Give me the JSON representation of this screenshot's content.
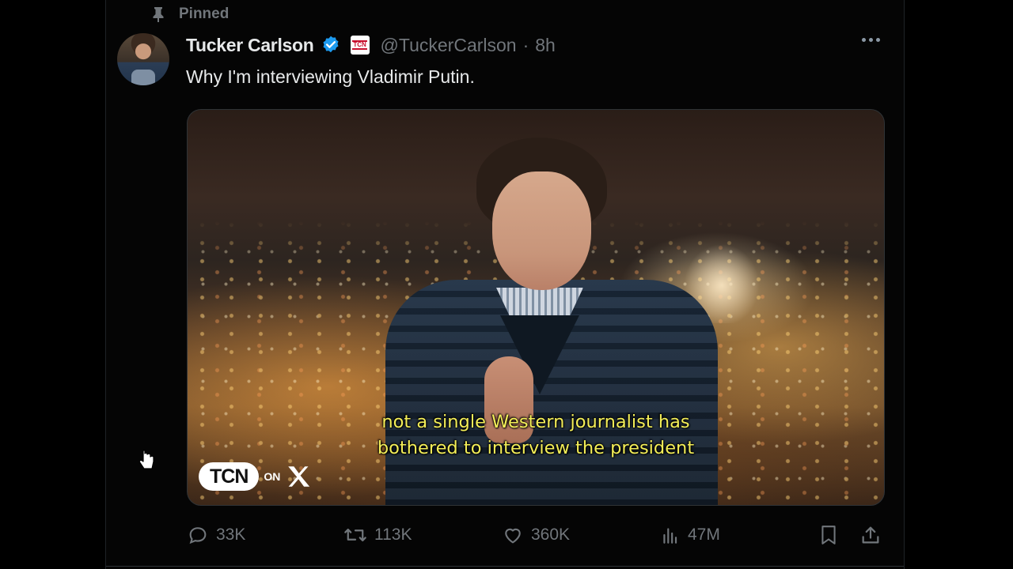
{
  "pinned": {
    "label": "Pinned"
  },
  "post": {
    "display_name": "Tucker Carlson",
    "handle": "@TuckerCarlson",
    "separator": "·",
    "time": "8h",
    "affiliate_badge": "TCN",
    "text": "Why I'm interviewing Vladimir Putin.",
    "video": {
      "caption_line_1": "not a single Western journalist has",
      "caption_line_2": "bothered to interview the president",
      "brand_tcn": "TCN",
      "brand_on": "ON"
    },
    "stats": {
      "replies": "33K",
      "reposts": "113K",
      "likes": "360K",
      "views": "47M"
    }
  },
  "colors": {
    "background": "#000000",
    "text_primary": "#e7e9ea",
    "text_secondary": "#71767b",
    "verified": "#1d9bf0",
    "caption": "#f3ee58"
  },
  "icons": [
    "pin-icon",
    "verified-icon",
    "more-icon",
    "reply-icon",
    "repost-icon",
    "like-icon",
    "views-icon",
    "bookmark-icon",
    "share-icon",
    "cursor-icon"
  ]
}
